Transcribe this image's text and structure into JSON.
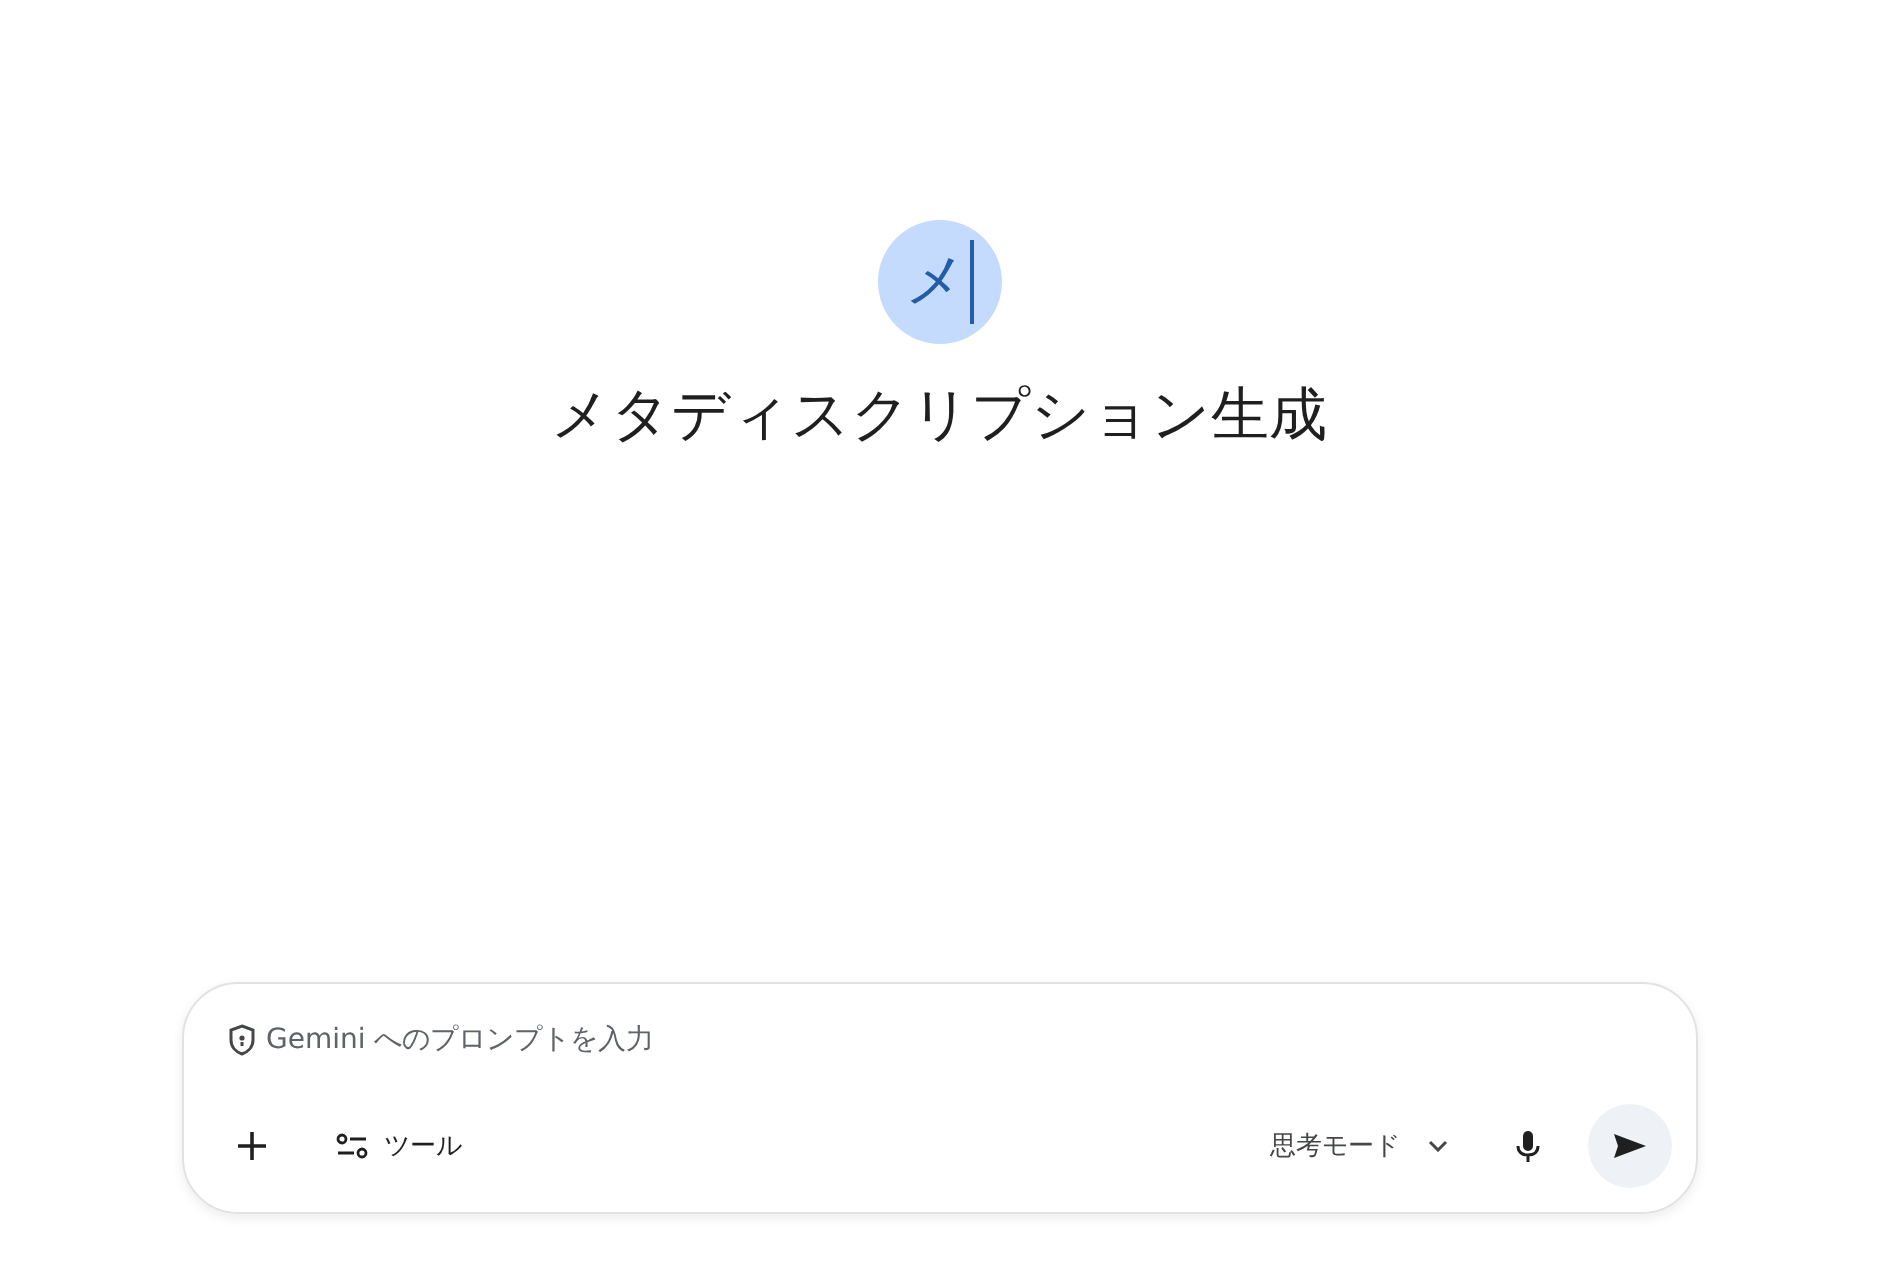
{
  "gem": {
    "avatar": "メ",
    "title": "メタディスクリプション生成"
  },
  "prompt": {
    "placeholder": "Gemini へのプロンプトを入力"
  },
  "toolbar": {
    "tools_label": "ツール",
    "mode_label": "思考モード"
  }
}
